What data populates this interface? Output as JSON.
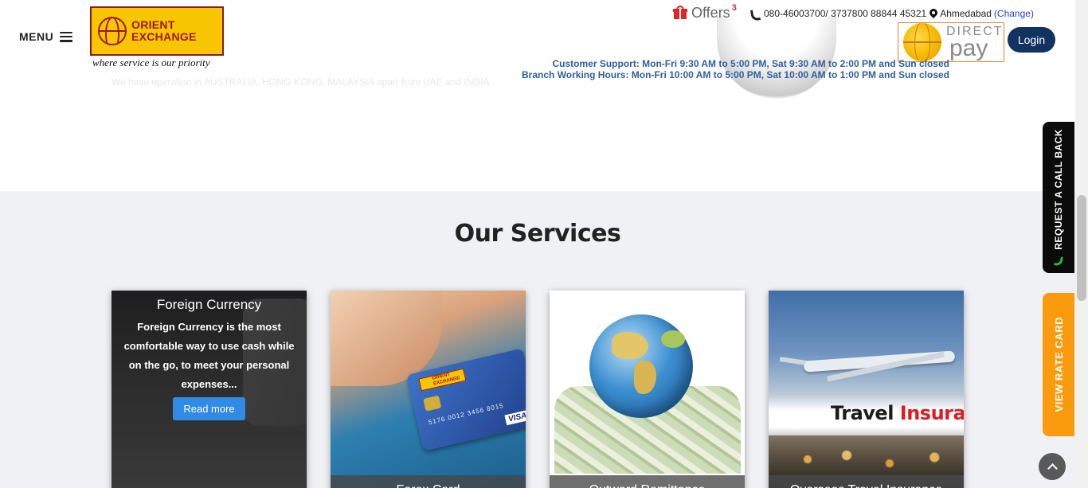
{
  "about": {
    "faded_text": "We have operation in AUSTRALIA, HONG-KONG, MALAYSIA apart from UAE and INDIA"
  },
  "header": {
    "menu_label": "MENU",
    "logo": {
      "line1": "ORIENT",
      "line2": "EXCHANGE",
      "tagline": "where service is our priority"
    },
    "offers_label": "Offers",
    "offers_count": "3",
    "phone": "080-46003700/ 3737800 88844 45321",
    "city": "Ahmedabad",
    "change_label": "(Change)",
    "directpay": {
      "word1": "DIRECT",
      "word2": "pay"
    },
    "login_label": "Login",
    "support_line": "Customer Support: Mon-Fri 9:30 AM to 5:00 PM, Sat 9:30 AM to 2:00 PM and Sun closed",
    "branch_line": "Branch Working Hours: Mon-Fri 10:00 AM to 5:00 PM, Sat 10:00 AM to 1:00 PM and Sun closed"
  },
  "side_tabs": {
    "callback_label": "REQUEST A CALL BACK",
    "rate_card_label": "VIEW RATE CARD",
    "callback_color": "#0b0b0b",
    "rate_card_color": "#f99b0c"
  },
  "services": {
    "title": "Our Services",
    "cards": [
      {
        "title": "Foreign Currency",
        "description": "Foreign Currency is the most comfortable way to use cash while on the go, to meet your personal expenses...",
        "button": "Read more"
      },
      {
        "title": "Forex Card",
        "card_logo": "ORIENT EXCHANGE",
        "card_number": "5176 0012 3456 8015",
        "card_brand": "VISA"
      },
      {
        "title": "Outward Remittance"
      },
      {
        "title": "Overseas Travel Insurance",
        "banner_word1": "Travel",
        "banner_word2": "Insura"
      }
    ]
  },
  "colors": {
    "login_bg": "#12325f",
    "read_more_bg": "#2f8be6",
    "support_text": "#2e5fa0",
    "offers_accent": "#e0252b",
    "logo_yellow": "#f7c600",
    "logo_red": "#a01818"
  },
  "icons": {
    "menu": "hamburger-icon",
    "offers": "gift-icon",
    "phone": "phone-icon",
    "location": "map-pin-icon",
    "callback": "phone-icon",
    "to_top": "chevron-up-icon"
  }
}
